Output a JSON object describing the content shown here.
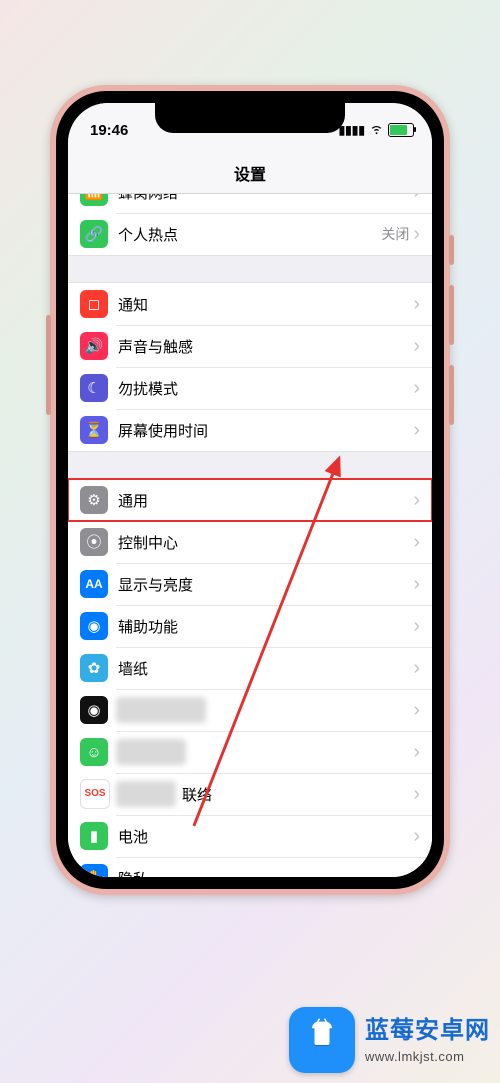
{
  "statusbar": {
    "time": "19:46"
  },
  "nav_title": "设置",
  "groups": [
    {
      "rows": [
        {
          "id": "cellular",
          "icon_name": "antenna-icon",
          "icon_bg": "bg-green",
          "glyph": "📶",
          "label": "蜂窝网络",
          "detail": ""
        },
        {
          "id": "hotspot",
          "icon_name": "link-icon",
          "icon_bg": "bg-green2",
          "glyph": "🔗",
          "label": "个人热点",
          "detail": "关闭"
        }
      ]
    },
    {
      "rows": [
        {
          "id": "notifications",
          "icon_name": "bell-icon",
          "icon_bg": "bg-red",
          "glyph": "◻︎",
          "label": "通知",
          "detail": ""
        },
        {
          "id": "sounds",
          "icon_name": "speaker-icon",
          "icon_bg": "bg-pink",
          "glyph": "🔊",
          "label": "声音与触感",
          "detail": ""
        },
        {
          "id": "dnd",
          "icon_name": "moon-icon",
          "icon_bg": "bg-purple",
          "glyph": "☾",
          "label": "勿扰模式",
          "detail": ""
        },
        {
          "id": "screentime",
          "icon_name": "hourglass-icon",
          "icon_bg": "bg-indigo",
          "glyph": "⏳",
          "label": "屏幕使用时间",
          "detail": ""
        }
      ]
    },
    {
      "rows": [
        {
          "id": "general",
          "icon_name": "gear-icon",
          "icon_bg": "bg-gray",
          "glyph": "⚙",
          "label": "通用",
          "detail": "",
          "highlight": true
        },
        {
          "id": "control",
          "icon_name": "toggles-icon",
          "icon_bg": "bg-gray2",
          "glyph": "⦿",
          "label": "控制中心",
          "detail": ""
        },
        {
          "id": "display",
          "icon_name": "text-size-icon",
          "icon_bg": "bg-blue",
          "glyph": "AA",
          "label": "显示与亮度",
          "detail": ""
        },
        {
          "id": "accessibility",
          "icon_name": "accessibility-icon",
          "icon_bg": "bg-blue2",
          "glyph": "◉",
          "label": "辅助功能",
          "detail": ""
        },
        {
          "id": "wallpaper",
          "icon_name": "flower-icon",
          "icon_bg": "bg-cyan",
          "glyph": "✿",
          "label": "墙纸",
          "detail": ""
        },
        {
          "id": "siri",
          "icon_name": "siri-icon",
          "icon_bg": "bg-black",
          "glyph": "◉",
          "label": "",
          "detail": "",
          "blurred": true
        },
        {
          "id": "faceid",
          "icon_name": "face-icon",
          "icon_bg": "bg-green3",
          "glyph": "☺",
          "label": "",
          "detail": "",
          "blurred": true
        },
        {
          "id": "sos",
          "icon_name": "sos-icon",
          "icon_bg": "bg-white",
          "glyph": "SOS",
          "label": "联络",
          "detail": "",
          "partial_blur": true
        },
        {
          "id": "battery",
          "icon_name": "battery-icon",
          "icon_bg": "bg-green",
          "glyph": "▮",
          "label": "电池",
          "detail": ""
        },
        {
          "id": "privacy",
          "icon_name": "hand-icon",
          "icon_bg": "bg-blue",
          "glyph": "✋",
          "label": "隐私",
          "detail": ""
        }
      ]
    }
  ],
  "watermark": {
    "title": "蓝莓安卓网",
    "url": "www.lmkjst.com"
  }
}
